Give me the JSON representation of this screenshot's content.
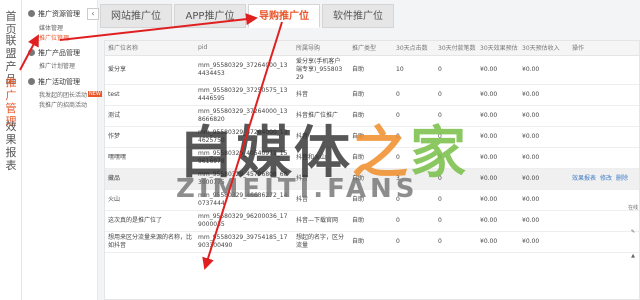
{
  "leftnav": {
    "items": [
      {
        "label": "首页",
        "active": false
      },
      {
        "label": "联盟产品",
        "active": false
      },
      {
        "label": "推广管理",
        "active": true
      },
      {
        "label": "效果报表",
        "active": false
      }
    ]
  },
  "submenu": {
    "collapse_icon": "chevron-left-icon",
    "groups": [
      {
        "title": "推广资源管理",
        "items": [
          {
            "label": "媒体管理",
            "active": false
          },
          {
            "label": "推广位管理",
            "active": true
          }
        ]
      },
      {
        "title": "推广产品管理",
        "items": [
          {
            "label": "推广计划管理",
            "active": false
          }
        ]
      },
      {
        "title": "推广活动管理",
        "items": [
          {
            "label": "我发起的团长活动",
            "active": false,
            "badge": "NEW"
          },
          {
            "label": "我推广的招商活动",
            "active": false
          }
        ]
      }
    ]
  },
  "tabs": [
    {
      "label": "网站推广位",
      "active": false
    },
    {
      "label": "APP推广位",
      "active": false
    },
    {
      "label": "导购推广位",
      "active": true
    },
    {
      "label": "软件推广位",
      "active": false
    }
  ],
  "table": {
    "headers": [
      "推广位名称",
      "pid",
      "所属导购",
      "推广类型",
      "30天点击数",
      "30天付款笔数",
      "30天效果预估",
      "30天预估收入",
      "操作"
    ],
    "rows": [
      {
        "name": "爱分享",
        "pid": "mm_95580329_37264000_134434453",
        "guide": "爱分享(手机客户端专享)_95580329",
        "type": "自助",
        "clicks": "10",
        "orders": "0",
        "effect": "¥0.00",
        "income": "¥0.00",
        "ops": []
      },
      {
        "name": "test",
        "pid": "mm_95580329_37250575_134446595",
        "guide": "抖音",
        "type": "自助",
        "clicks": "0",
        "orders": "0",
        "effect": "¥0.00",
        "income": "¥0.00",
        "ops": []
      },
      {
        "name": "测试",
        "pid": "mm_95580329_37264000_138666820",
        "guide": "抖音推广位推广",
        "type": "自助",
        "clicks": "0",
        "orders": "0",
        "effect": "¥0.00",
        "income": "¥0.00",
        "ops": []
      },
      {
        "name": "作梦",
        "pid": "mm_95580329_37264000_134625750",
        "guide": "抖音",
        "type": "自助",
        "clicks": "0",
        "orders": "0",
        "effect": "¥0.00",
        "income": "¥0.00",
        "ops": []
      },
      {
        "name": "嘿嘿嘿",
        "pid": "mm_95580329_40540971_159616978",
        "guide": "抖音和火山",
        "type": "自助",
        "clicks": "0",
        "orders": "0",
        "effect": "¥0.00",
        "income": "¥0.00",
        "ops": []
      },
      {
        "name": "藏品",
        "pid": "mm_95580329_45796808_683900775",
        "guide": "抖音",
        "type": "自助",
        "clicks": "3",
        "orders": "0",
        "effect": "¥0.00",
        "income": "¥0.00",
        "ops": [
          "效果报表",
          "修改",
          "删除"
        ],
        "highlight": true
      },
      {
        "name": "火山",
        "pid": "mm_95580329_46686272_140737444",
        "guide": "抖音",
        "type": "自助",
        "clicks": "0",
        "orders": "0",
        "effect": "¥0.00",
        "income": "¥0.00",
        "ops": []
      },
      {
        "name": "这次真的是推广位了",
        "pid": "mm_95580329_96200036_179000035",
        "guide": "抖音—下载官网",
        "type": "自助",
        "clicks": "0",
        "orders": "0",
        "effect": "¥0.00",
        "income": "¥0.00",
        "ops": []
      },
      {
        "name": "想用来区分流量来源的名称，比如抖音",
        "pid": "mm_95580329_39754185_17903300490",
        "guide": "想起的名字，区分流量",
        "type": "自助",
        "clicks": "0",
        "orders": "0",
        "effect": "¥0.00",
        "income": "¥0.00",
        "ops": []
      }
    ]
  },
  "watermark": {
    "line1_a": "自媒体",
    "line1_b": "之",
    "line1_c": "家",
    "line2": "ZIMEITI.FANS"
  },
  "rightfloat": {
    "items": [
      {
        "label": "在线",
        "icon": "chat-icon"
      },
      {
        "label": "",
        "icon": "feedback-icon"
      },
      {
        "label": "",
        "icon": "top-icon"
      }
    ]
  },
  "colors": {
    "accent": "#e8562a",
    "arrow": "#e02020",
    "link": "#3f7cc8"
  }
}
